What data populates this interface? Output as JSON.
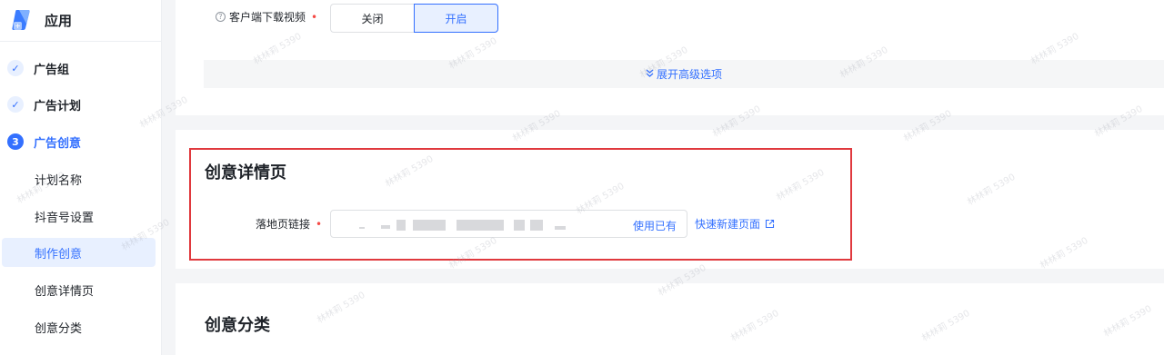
{
  "sidebar": {
    "app_title": "应用",
    "steps": [
      {
        "label": "广告组",
        "state": "done",
        "marker": "✓"
      },
      {
        "label": "广告计划",
        "state": "done",
        "marker": "✓"
      },
      {
        "label": "广告创意",
        "state": "active",
        "marker": "3"
      }
    ],
    "sub_items": [
      {
        "label": "计划名称"
      },
      {
        "label": "抖音号设置"
      },
      {
        "label": "制作创意",
        "selected": true
      },
      {
        "label": "创意详情页"
      },
      {
        "label": "创意分类"
      }
    ]
  },
  "video_download": {
    "label": "客户端下载视频",
    "required_mark": "•",
    "help_icon": "?",
    "options": [
      "关闭",
      "开启"
    ],
    "selected": "开启"
  },
  "advanced": {
    "label": "展开高级选项",
    "icon": "double-chevron-down"
  },
  "detail_section": {
    "title": "创意详情页",
    "landing_label": "落地页链接",
    "required_mark": "•",
    "use_existing": "使用已有",
    "quick_create": "快速新建页面"
  },
  "category_section": {
    "title": "创意分类"
  },
  "watermark": "林林莉 5390",
  "colors": {
    "accent": "#3370ff",
    "accent_bg": "#e8f0ff",
    "required": "#f54a45",
    "annotation_border": "#e0393e"
  }
}
